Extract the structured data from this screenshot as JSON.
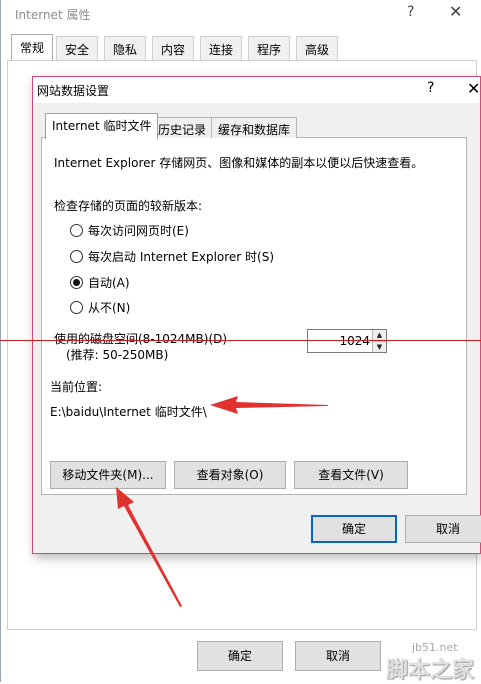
{
  "background_window": {
    "title": "Internet 属性",
    "help_glyph": "?",
    "close_glyph": "✕",
    "tabs": [
      "常规",
      "安全",
      "隐私",
      "内容",
      "连接",
      "程序",
      "高级"
    ],
    "active_tab": 0,
    "buttons": {
      "ok": "确定",
      "cancel": "取消"
    }
  },
  "dialog": {
    "title": "网站数据设置",
    "help_glyph": "?",
    "close_glyph": "✕",
    "tabs": [
      "Internet 临时文件",
      "历史记录",
      "缓存和数据库"
    ],
    "active_tab": 0,
    "description": "Internet Explorer 存储网页、图像和媒体的副本以便以后快速查看。",
    "check_label": "检查存储的页面的较新版本:",
    "radio_options": [
      {
        "label": "每次访问网页时(E)",
        "checked": false
      },
      {
        "label": "每次启动 Internet Explorer 时(S)",
        "checked": false
      },
      {
        "label": "自动(A)",
        "checked": true
      },
      {
        "label": "从不(N)",
        "checked": false
      }
    ],
    "disk_space_label": "使用的磁盘空间(8-1024MB)(D)",
    "disk_space_recommend": "(推荐: 50-250MB)",
    "disk_space_value": "1024",
    "current_location_label": "当前位置:",
    "current_location_value": "E:\\baidu\\Internet 临时文件\\",
    "buttons": {
      "move_folder": "移动文件夹(M)...",
      "view_objects": "查看对象(O)",
      "view_files": "查看文件(V)",
      "ok": "确定",
      "cancel": "取消"
    }
  },
  "annotations": {
    "arrow_color": "#e0322f",
    "line_color": "#c51f1f"
  },
  "watermark": {
    "url": "jb51.net",
    "text": "脚本之家"
  }
}
